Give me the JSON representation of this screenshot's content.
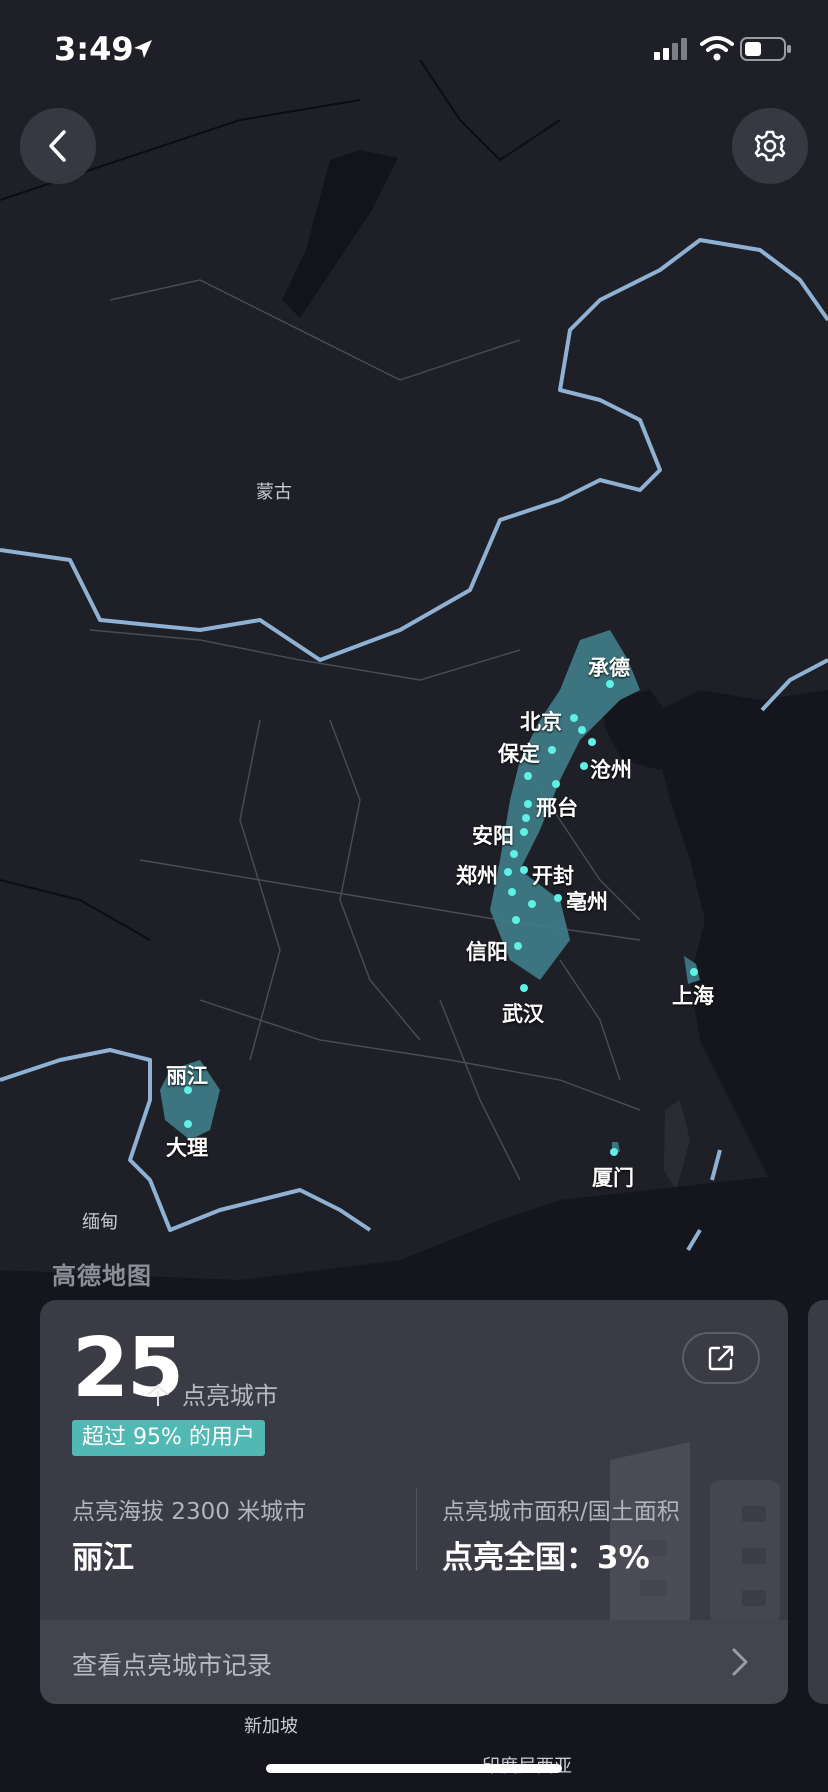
{
  "status_bar": {
    "time": "3:49"
  },
  "map": {
    "base_labels": {
      "mongolia": "蒙古",
      "myanmar": "缅甸",
      "singapore": "新加坡",
      "indonesia": "印度尼西亚"
    },
    "cities": [
      "承德",
      "北京",
      "保定",
      "沧州",
      "邢台",
      "安阳",
      "郑州",
      "开封",
      "亳州",
      "信阳",
      "武汉",
      "上海",
      "丽江",
      "大理",
      "厦门"
    ],
    "logo": "高德地图"
  },
  "card": {
    "count": "25",
    "unit": "个",
    "count_label": "点亮城市",
    "badge": "超过 95% 的用户",
    "stat_left": {
      "title": "点亮海拔 2300 米城市",
      "value": "丽江"
    },
    "stat_right": {
      "title": "点亮城市面积/国土面积",
      "value": "点亮全国：3%"
    },
    "footer_link": "查看点亮城市记录"
  },
  "colors": {
    "background": "#1f2027",
    "border": "#8fb2d4",
    "highlight_region": "#3f7e8a",
    "dot": "#5ff0e6",
    "card": "#3a3b45",
    "badge": "#51b8b3"
  }
}
